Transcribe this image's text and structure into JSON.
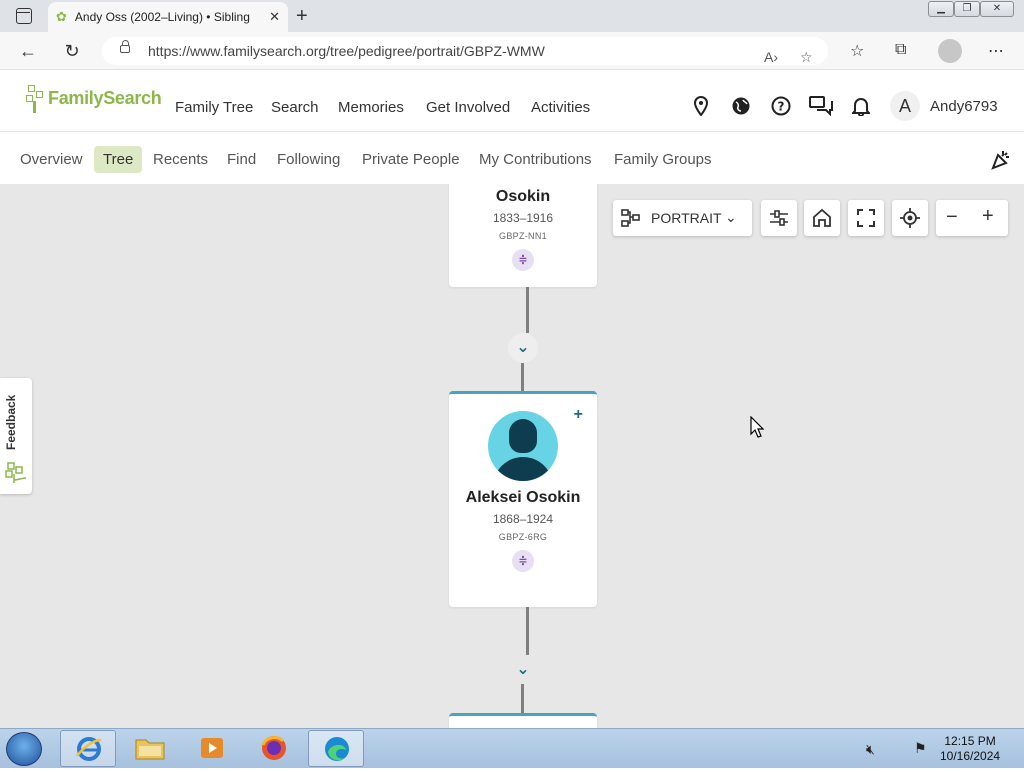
{
  "browser": {
    "tab_title": "Andy Oss (2002–Living) • Sibling",
    "url": "https://www.familysearch.org/tree/pedigree/portrait/GBPZ-WMW"
  },
  "header": {
    "logo_text": "FamilySearch",
    "nav": [
      "Family Tree",
      "Search",
      "Memories",
      "Get Involved",
      "Activities"
    ],
    "avatar_letter": "A",
    "username": "Andy6793"
  },
  "subnav": {
    "items": [
      "Overview",
      "Tree",
      "Recents",
      "Find",
      "Following",
      "Private People",
      "My Contributions",
      "Family Groups"
    ],
    "active": "Tree"
  },
  "tree": {
    "view_label": "PORTRAIT",
    "persons": [
      {
        "name": "Osokin",
        "dates": "1833–1916",
        "pid": "GBPZ-NN1"
      },
      {
        "name": "Aleksei Osokin",
        "dates": "1868–1924",
        "pid": "GBPZ-6RG"
      }
    ]
  },
  "feedback": {
    "label": "Feedback"
  },
  "taskbar": {
    "time": "12:15 PM",
    "date": "10/16/2024"
  },
  "colors": {
    "brand_green": "#8cb84a",
    "active_tab_bg": "#dde9c4",
    "canvas_bg": "#e7e7e7",
    "accent_teal": "#1d6c86"
  }
}
